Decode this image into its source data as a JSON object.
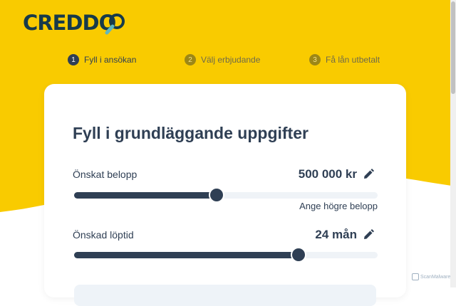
{
  "brand": {
    "logo_text": "CREDDO"
  },
  "steps": [
    {
      "number": "1",
      "label": "Fyll i ansökan",
      "active": true
    },
    {
      "number": "2",
      "label": "Välj erbjudande",
      "active": false
    },
    {
      "number": "3",
      "label": "Få lån utbetalt",
      "active": false
    }
  ],
  "form": {
    "title": "Fyll i grundläggande uppgifter",
    "amount": {
      "label": "Önskat belopp",
      "value": "500 000 kr",
      "slider_fraction": 0.47,
      "hint": "Ange högre belopp"
    },
    "term": {
      "label": "Önskad löptid",
      "value": "24 mån",
      "slider_fraction": 0.74
    }
  },
  "watermark": {
    "text": "ScanMalware"
  },
  "colors": {
    "brand_yellow": "#f9cb00",
    "navy": "#2f3f54",
    "logo_dark": "#173a4a"
  }
}
